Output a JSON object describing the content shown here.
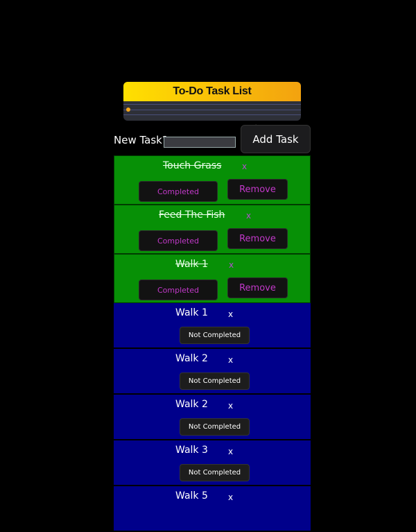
{
  "header": {
    "title": "To-Do Task List"
  },
  "new_task": {
    "label": "New Task?",
    "value": "",
    "button": "Add Task"
  },
  "tasks": [
    {
      "name": "Touch Grass",
      "status": "Completed",
      "remove": "Remove",
      "x": "x"
    },
    {
      "name": "Feed The Fish",
      "status": "Completed",
      "remove": "Remove",
      "x": "x"
    },
    {
      "name": "Walk 1",
      "status": "Completed",
      "remove": "Remove",
      "x": "x"
    },
    {
      "name": "Walk 1",
      "status": "Not Completed",
      "x": "x"
    },
    {
      "name": "Walk 2",
      "status": "Not Completed",
      "x": "x"
    },
    {
      "name": "Walk 2",
      "status": "Not Completed",
      "x": "x"
    },
    {
      "name": "Walk 3",
      "status": "Not Completed",
      "x": "x"
    },
    {
      "name": "Walk 5",
      "x": "x"
    }
  ],
  "colors": {
    "completed_bg": "#079006",
    "pending_bg": "#00008b",
    "title_gradient_start": "#ffe000",
    "title_gradient_end": "#f3a20f",
    "completed_text": "#c239c9"
  }
}
